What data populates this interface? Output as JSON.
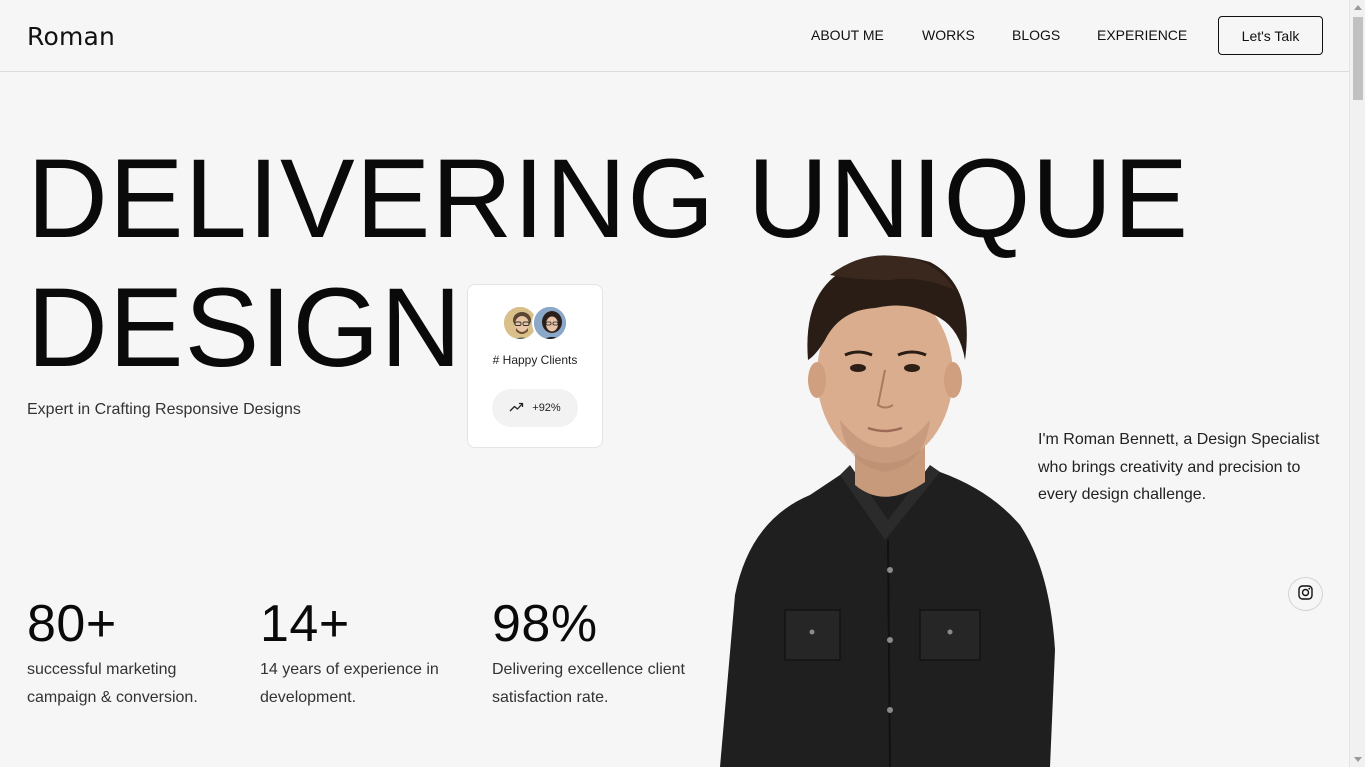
{
  "brand": {
    "logo": "Roman"
  },
  "nav": {
    "about": "ABOUT ME",
    "works": "WORKS",
    "blogs": "BLOGS",
    "experience": "EXPERIENCE",
    "cta": "Let's Talk"
  },
  "hero": {
    "line1": "DELIVERING UNIQUE",
    "line2": "DESIGN",
    "subtitle": "Expert in Crafting Responsive Designs"
  },
  "clients_card": {
    "label": "# Happy Clients",
    "growth": "+92%",
    "growth_icon": "trending-up-icon"
  },
  "intro": {
    "text": "I'm Roman Bennett, a Design Specialist who brings creativity and precision to every design challenge."
  },
  "social": {
    "instagram_icon": "instagram-icon"
  },
  "stats": [
    {
      "value": "80+",
      "description": "successful marketing campaign & conversion."
    },
    {
      "value": "14+",
      "description": "14 years of experience in development."
    },
    {
      "value": "98%",
      "description": "Delivering excellence client satisfaction rate."
    }
  ],
  "colors": {
    "background": "#f6f6f6",
    "text": "#111111",
    "card": "#ffffff"
  }
}
